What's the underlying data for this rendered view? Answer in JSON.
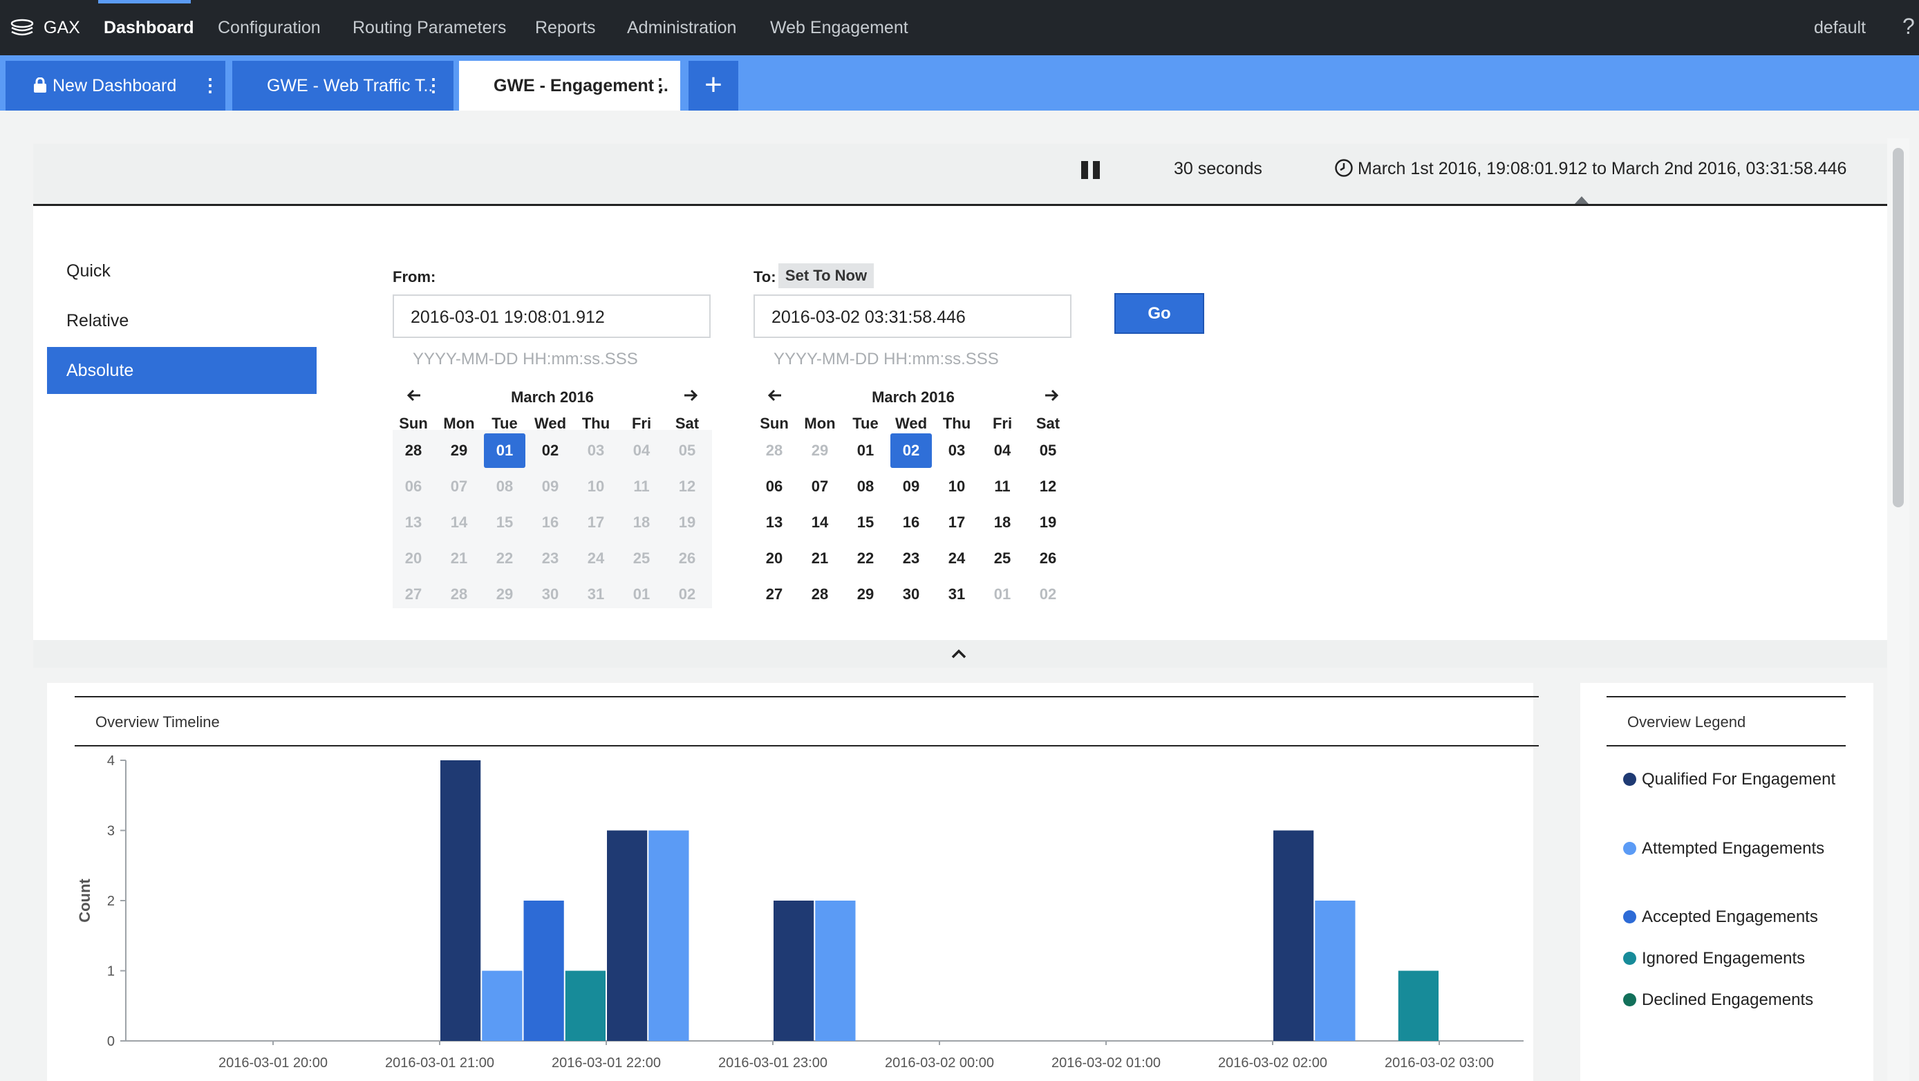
{
  "nav": {
    "brand": "GAX",
    "items": [
      "Dashboard",
      "Configuration",
      "Routing Parameters",
      "Reports",
      "Administration",
      "Web Engagement"
    ],
    "user": "default",
    "help": "?"
  },
  "tabs": [
    {
      "label": "New Dashboard",
      "locked": true,
      "menu": "⋮"
    },
    {
      "label": "GWE - Web Traffic T..",
      "menu": "⋮"
    },
    {
      "label": "GWE - Engagement ..",
      "menu": "⋮",
      "selected": true
    }
  ],
  "add_tab": "+",
  "timebar": {
    "refresh": "30 seconds",
    "range": "March 1st 2016, 19:08:01.912 to March 2nd 2016, 03:31:58.446"
  },
  "modes": [
    "Quick",
    "Relative",
    "Absolute"
  ],
  "from": {
    "label": "From:",
    "value": "2016-03-01 19:08:01.912",
    "format": "YYYY-MM-DD HH:mm:ss.SSS"
  },
  "to": {
    "label": "To:",
    "set_now": "Set To Now",
    "value": "2016-03-02 03:31:58.446",
    "format": "YYYY-MM-DD HH:mm:ss.SSS"
  },
  "go": "Go",
  "calendars": {
    "from": {
      "month": "March 2016",
      "dow": [
        "Sun",
        "Mon",
        "Tue",
        "Wed",
        "Thu",
        "Fri",
        "Sat"
      ],
      "days": [
        "28",
        "29",
        "01",
        "02",
        "03",
        "04",
        "05",
        "06",
        "07",
        "08",
        "09",
        "10",
        "11",
        "12",
        "13",
        "14",
        "15",
        "16",
        "17",
        "18",
        "19",
        "20",
        "21",
        "22",
        "23",
        "24",
        "25",
        "26",
        "27",
        "28",
        "29",
        "30",
        "31",
        "01",
        "02"
      ],
      "selected_index": 2,
      "enabled_indexes": [
        0,
        1,
        2,
        3
      ]
    },
    "to": {
      "month": "March 2016",
      "dow": [
        "Sun",
        "Mon",
        "Tue",
        "Wed",
        "Thu",
        "Fri",
        "Sat"
      ],
      "days": [
        "28",
        "29",
        "01",
        "02",
        "03",
        "04",
        "05",
        "06",
        "07",
        "08",
        "09",
        "10",
        "11",
        "12",
        "13",
        "14",
        "15",
        "16",
        "17",
        "18",
        "19",
        "20",
        "21",
        "22",
        "23",
        "24",
        "25",
        "26",
        "27",
        "28",
        "29",
        "30",
        "31",
        "01",
        "02"
      ],
      "selected_index": 3,
      "disabled_indexes": [
        0,
        1,
        33,
        34
      ]
    }
  },
  "timeline": {
    "title": "Overview Timeline"
  },
  "legend": {
    "title": "Overview Legend",
    "items": [
      {
        "label": "Qualified For Engagement",
        "color": "#1f3a73"
      },
      {
        "label": "Attempted Engagements",
        "color": "#5b9bf5"
      },
      {
        "label": "Accepted Engagements",
        "color": "#2d6bd6"
      },
      {
        "label": "Ignored Engagements",
        "color": "#178b99"
      },
      {
        "label": "Declined Engagements",
        "color": "#12705a"
      }
    ]
  },
  "chart_data": {
    "type": "bar",
    "ylabel": "Count",
    "xlabel": "",
    "ylim": [
      0,
      4
    ],
    "yticks": [
      0,
      1,
      2,
      3,
      4
    ],
    "xticks": [
      "2016-03-01 20:00",
      "2016-03-01 21:00",
      "2016-03-01 22:00",
      "2016-03-01 23:00",
      "2016-03-02 00:00",
      "2016-03-02 01:00",
      "2016-03-02 02:00",
      "2016-03-02 03:00"
    ],
    "bucket_minutes": 15,
    "series": [
      {
        "name": "Qualified For Engagement",
        "color": "#1f3a73",
        "points": [
          [
            "2016-03-01 21:00",
            4
          ],
          [
            "2016-03-01 22:00",
            3
          ],
          [
            "2016-03-01 23:00",
            2
          ],
          [
            "2016-03-02 02:00",
            3
          ]
        ]
      },
      {
        "name": "Attempted Engagements",
        "color": "#5b9bf5",
        "points": [
          [
            "2016-03-01 21:15",
            1
          ],
          [
            "2016-03-01 22:15",
            3
          ],
          [
            "2016-03-01 23:15",
            2
          ],
          [
            "2016-03-02 02:15",
            2
          ]
        ]
      },
      {
        "name": "Accepted Engagements",
        "color": "#2d6bd6",
        "points": [
          [
            "2016-03-01 21:30",
            2
          ]
        ]
      },
      {
        "name": "Ignored Engagements",
        "color": "#178b99",
        "points": [
          [
            "2016-03-01 21:45",
            1
          ],
          [
            "2016-03-02 02:45",
            1
          ]
        ]
      },
      {
        "name": "Declined Engagements",
        "color": "#12705a",
        "points": []
      }
    ]
  }
}
